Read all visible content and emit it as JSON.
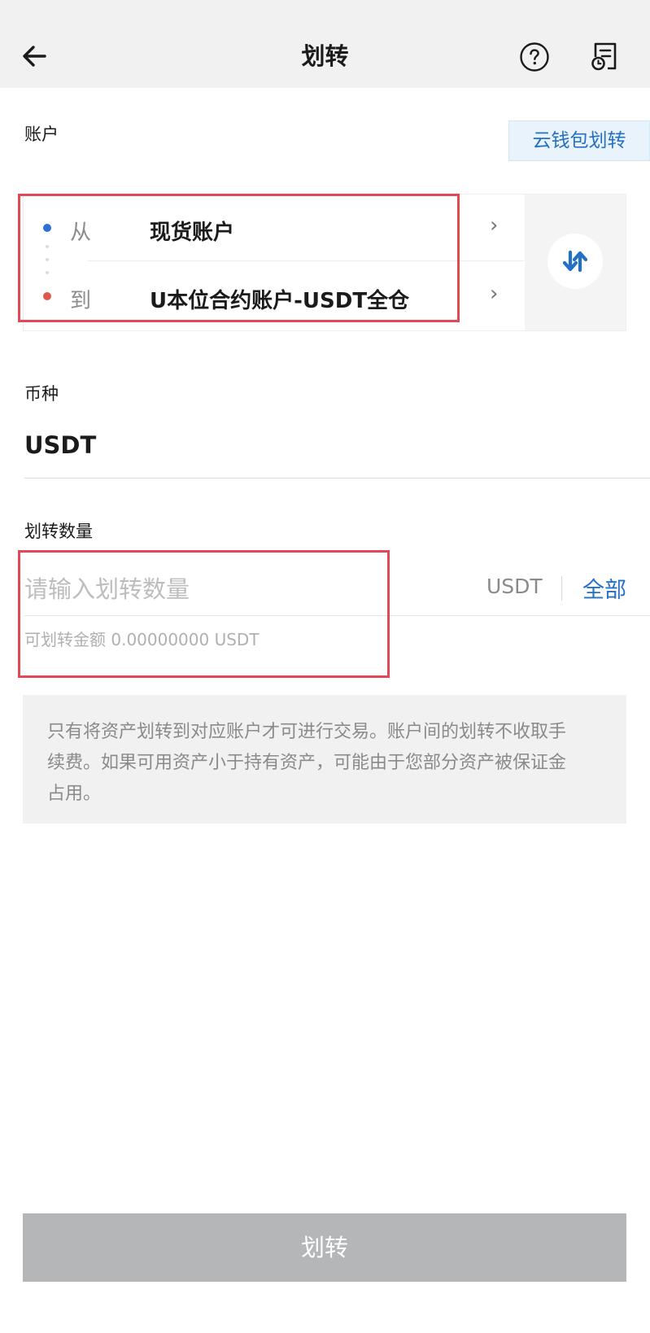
{
  "header": {
    "title": "划转",
    "back_icon": "arrow-left-icon",
    "help_icon": "question-circle-icon",
    "record_icon": "transfer-record-icon"
  },
  "account_section": {
    "label": "账户",
    "cloud_wallet_button": "云钱包划转",
    "from": {
      "prefix": "从",
      "value": "现货账户",
      "dot_color": "#2c6fd6"
    },
    "to": {
      "prefix": "到",
      "value": "U本位合约账户-USDT全仓",
      "dot_color": "#e0584a"
    },
    "swap_icon": "swap-vertical-icon"
  },
  "currency_section": {
    "label": "币种",
    "value": "USDT"
  },
  "amount_section": {
    "label": "划转数量",
    "placeholder": "请输入划转数量",
    "unit": "USDT",
    "all_button": "全部",
    "available": "可划转金额 0.00000000 USDT"
  },
  "note": {
    "line1": "只有将资产划转到对应账户才可进行交易。账户间的划转不收取手",
    "line2": "续费。如果可用资产小于持有资产，可能由于您部分资产被保证金",
    "line3": "占用。"
  },
  "submit": {
    "label": "划转"
  },
  "colors": {
    "accent": "#2470c4",
    "highlight_border": "#e04a55",
    "disabled_button": "#b4b6b8"
  }
}
